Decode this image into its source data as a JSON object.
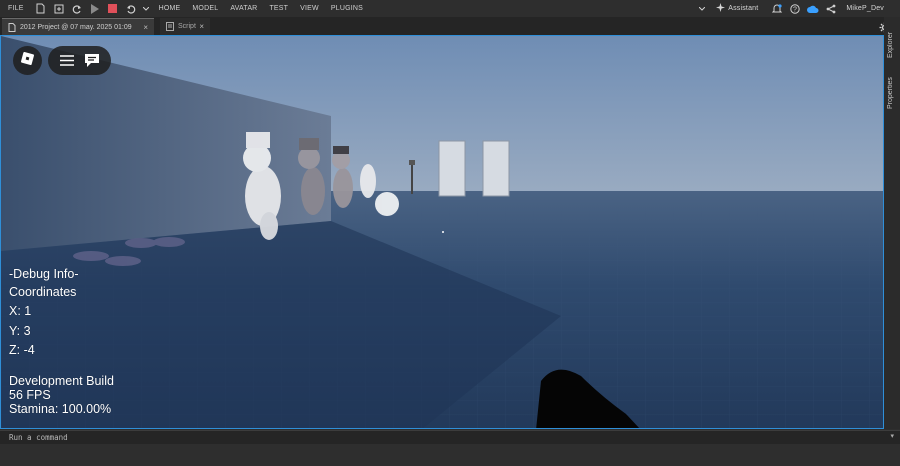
{
  "menubar": {
    "file": "FILE",
    "items": [
      "HOME",
      "MODEL",
      "AVATAR",
      "TEST",
      "VIEW",
      "PLUGINS"
    ],
    "assistant": "Assistant",
    "user": "MikeP_Dev"
  },
  "tabs": {
    "project": "2012 Project @ 07 may. 2025 01:09",
    "script": "Script",
    "close_glyph": "×"
  },
  "side_panel": {
    "explorer": "Explorer",
    "properties": "Properties"
  },
  "debug": {
    "header": "-Debug Info-",
    "coords_label": "Coordinates",
    "x": "X: 1",
    "y": "Y: 3",
    "z": "Z: -4",
    "build": "Development Build",
    "fps": "56 FPS",
    "stamina": "Stamina: 100.00%"
  },
  "command_bar": {
    "placeholder": "Run a command",
    "arrow": "▾"
  },
  "colors": {
    "viewport_border": "#2f8fd8",
    "stop_button": "#e0505a",
    "play_button": "#8a8a8a",
    "accent_blue": "#3aa0ff"
  },
  "icons": [
    "new-file-icon",
    "open-icon",
    "redo-icon",
    "play-icon",
    "stop-icon",
    "undo-icon",
    "chevron-down-icon",
    "assistant-icon",
    "notification-icon",
    "help-icon",
    "cloud-icon",
    "share-icon",
    "settings-icon",
    "roblox-logo-icon",
    "hamburger-menu-icon",
    "chat-icon"
  ]
}
